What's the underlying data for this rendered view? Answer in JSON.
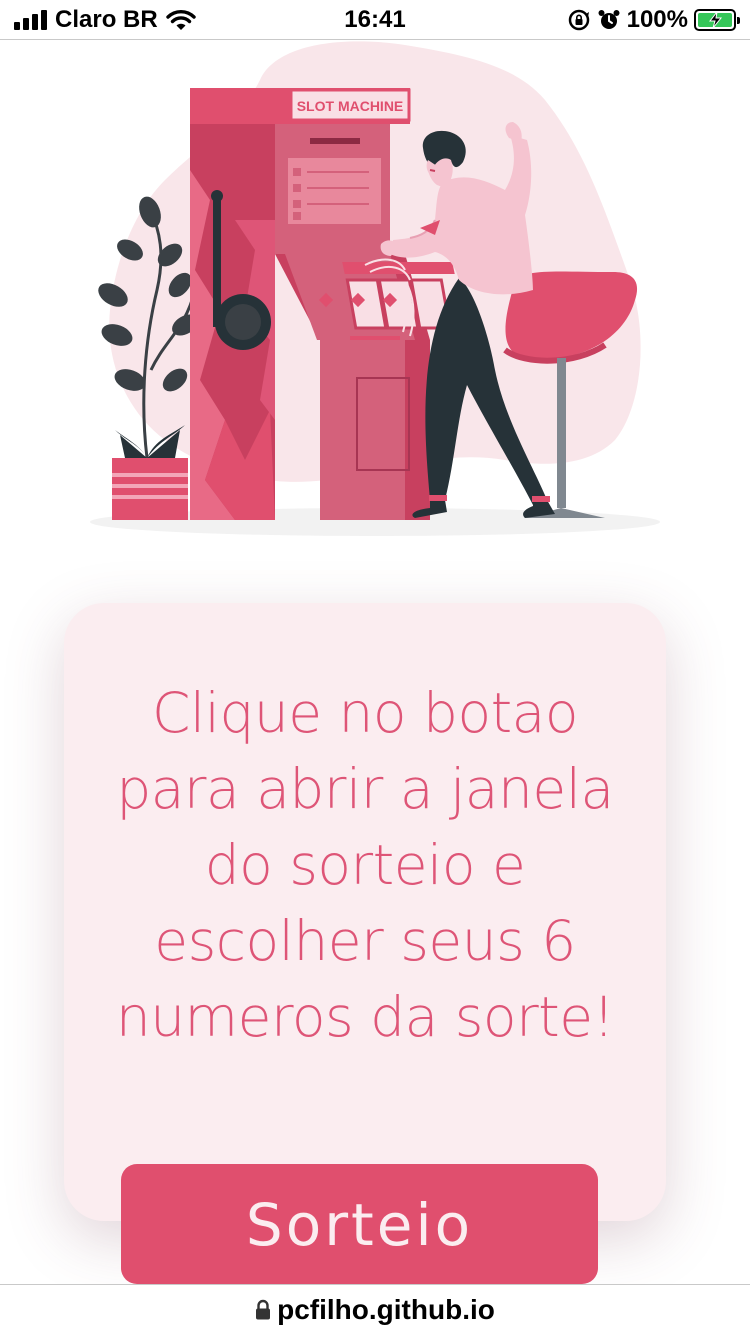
{
  "status_bar": {
    "carrier": "Claro BR",
    "time": "16:41",
    "battery_percent": "100%",
    "battery_level": 1.0,
    "icons": [
      "signal-icon",
      "wifi-icon",
      "rotation-lock-icon",
      "alarm-icon",
      "battery-charging-icon"
    ]
  },
  "illustration": {
    "sign_text": "SLOT MACHINE",
    "colors": {
      "primary": "#e04f6e",
      "light": "#f9dfe5",
      "dark": "#263238"
    }
  },
  "card": {
    "message": "Clique no botao para abrir a janela do sorteio e escolher seus 6 numeros da sorte!",
    "lines": [
      "Clique no botao",
      "para abrir a janela",
      "do sorteio e",
      "escolher seus 6",
      "numeros da sorte!"
    ],
    "background": "#fbedf0",
    "text_color": "#de5577"
  },
  "button": {
    "label": "Sorteio",
    "color": "#e04f6e"
  },
  "url_bar": {
    "url": "pcfilho.github.io",
    "icon": "lock-icon"
  }
}
